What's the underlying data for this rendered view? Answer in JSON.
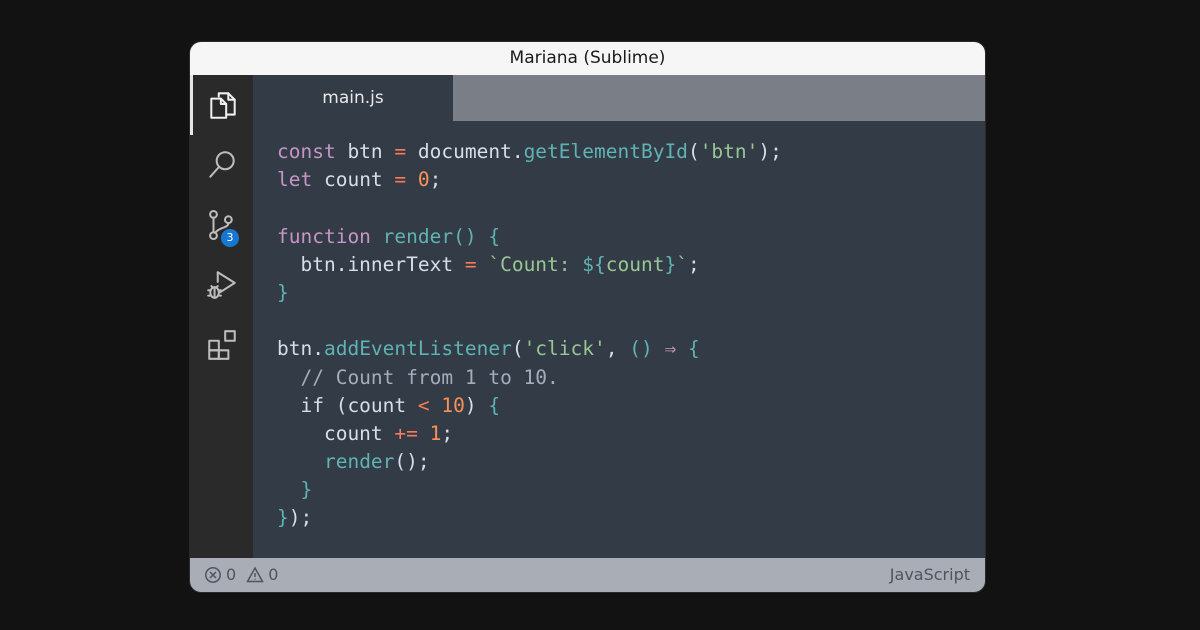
{
  "window": {
    "title": "Mariana (Sublime)"
  },
  "activity_bar": {
    "items": [
      {
        "name": "explorer",
        "icon": "files-icon",
        "active": true
      },
      {
        "name": "search",
        "icon": "search-icon"
      },
      {
        "name": "source-control",
        "icon": "git-branch-icon",
        "badge": "3"
      },
      {
        "name": "run-debug",
        "icon": "run-debug-icon"
      },
      {
        "name": "extensions",
        "icon": "extensions-icon"
      }
    ]
  },
  "tabs": [
    {
      "label": "main.js",
      "active": true
    }
  ],
  "editor": {
    "language": "javascript",
    "lines": [
      [
        {
          "t": "const",
          "c": "kw"
        },
        {
          "t": " btn "
        },
        {
          "t": "=",
          "c": "op"
        },
        {
          "t": " document."
        },
        {
          "t": "getElementById",
          "c": "fn"
        },
        {
          "t": "("
        },
        {
          "t": "'btn'",
          "c": "str"
        },
        {
          "t": ");"
        }
      ],
      [
        {
          "t": "let",
          "c": "kw"
        },
        {
          "t": " count "
        },
        {
          "t": "=",
          "c": "op"
        },
        {
          "t": " "
        },
        {
          "t": "0",
          "c": "num"
        },
        {
          "t": ";"
        }
      ],
      [],
      [
        {
          "t": "function",
          "c": "kw"
        },
        {
          "t": " "
        },
        {
          "t": "render",
          "c": "fn"
        },
        {
          "t": "() {",
          "c": "fn"
        }
      ],
      [
        {
          "t": "  btn.innerText "
        },
        {
          "t": "=",
          "c": "op"
        },
        {
          "t": " "
        },
        {
          "t": "`Count: ",
          "c": "str"
        },
        {
          "t": "${",
          "c": "fn"
        },
        {
          "t": "count",
          "c": "str"
        },
        {
          "t": "}",
          "c": "fn"
        },
        {
          "t": "`",
          "c": "str"
        },
        {
          "t": ";"
        }
      ],
      [
        {
          "t": "}",
          "c": "fn"
        }
      ],
      [],
      [
        {
          "t": "btn."
        },
        {
          "t": "addEventListener",
          "c": "fn"
        },
        {
          "t": "("
        },
        {
          "t": "'click'",
          "c": "str"
        },
        {
          "t": ", "
        },
        {
          "t": "()",
          "c": "fn"
        },
        {
          "t": " "
        },
        {
          "t": "⇒",
          "c": "kw"
        },
        {
          "t": " "
        },
        {
          "t": "{",
          "c": "fn"
        }
      ],
      [
        {
          "t": "  "
        },
        {
          "t": "// Count from 1 to 10.",
          "c": "com"
        }
      ],
      [
        {
          "t": "  if (count "
        },
        {
          "t": "<",
          "c": "op"
        },
        {
          "t": " "
        },
        {
          "t": "10",
          "c": "num"
        },
        {
          "t": ") "
        },
        {
          "t": "{",
          "c": "fn"
        }
      ],
      [
        {
          "t": "    count "
        },
        {
          "t": "+=",
          "c": "op"
        },
        {
          "t": " "
        },
        {
          "t": "1",
          "c": "num"
        },
        {
          "t": ";"
        }
      ],
      [
        {
          "t": "    "
        },
        {
          "t": "render",
          "c": "fn"
        },
        {
          "t": "();"
        }
      ],
      [
        {
          "t": "  "
        },
        {
          "t": "}",
          "c": "fn"
        }
      ],
      [
        {
          "t": "}",
          "c": "fn"
        },
        {
          "t": ");"
        }
      ]
    ]
  },
  "status_bar": {
    "errors": "0",
    "warnings": "0",
    "language_mode": "JavaScript"
  },
  "colors": {
    "background": "#121212",
    "editor_bg": "#333b46",
    "activity_bg": "#2a2a2b",
    "tabbar_bg": "#7a7f87",
    "statusbar_bg": "#a8adb6",
    "keyword": "#c695c6",
    "function": "#5fb3b3",
    "string": "#99c794",
    "number": "#f99157",
    "operator": "#f97b58",
    "comment": "#a6acb9",
    "badge": "#1778d4"
  }
}
